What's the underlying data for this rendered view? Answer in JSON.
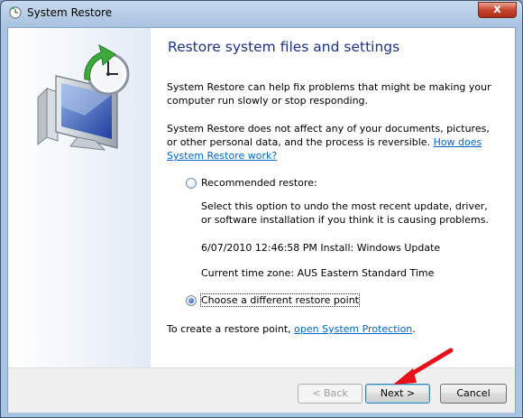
{
  "window": {
    "title": "System Restore",
    "close_glyph": "x"
  },
  "main": {
    "heading": "Restore system files and settings",
    "intro": "System Restore can help fix problems that might be making your computer run slowly or stop responding.",
    "info": "System Restore does not affect any of your documents, pictures, or other personal data, and the process is reversible.",
    "info_link": "How does System Restore work?",
    "options": {
      "recommended": {
        "label": "Recommended restore:",
        "selected": false,
        "description": "Select this option to undo the most recent update, driver, or software installation if you think it is causing problems.",
        "restore_point": "6/07/2010 12:46:58 PM Install: Windows Update",
        "time_zone": "Current time zone: AUS Eastern Standard Time"
      },
      "different": {
        "label": "Choose a different restore point",
        "selected": true
      }
    },
    "protection_text": "To create a restore point,",
    "protection_link": "open System Protection",
    "protection_end": "."
  },
  "footer": {
    "back_label": "< Back",
    "next_label": "Next >",
    "cancel_label": "Cancel"
  },
  "colors": {
    "heading": "#1e3287",
    "link": "#0066cc",
    "annotation_arrow": "#e8101a"
  },
  "icons": {
    "title": "system-restore-icon",
    "hero": "computer-clock-restore-icon",
    "annotation": "red-arrow-icon"
  }
}
